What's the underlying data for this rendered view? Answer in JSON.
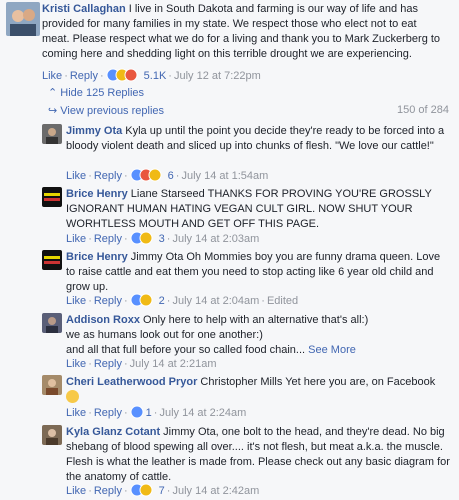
{
  "main_comment": {
    "author": "Kristi Callaghan",
    "text": "I live in South Dakota and farming is our way of life and has provided for many families in my state. We respect those who elect not to eat meat. Please respect what we do for a living and thank you to Mark Zuckerberg to coming here and shedding light on this terrible drought we are experiencing.",
    "like": "Like",
    "reply": "Reply",
    "reaction_count": "5.1K",
    "time": "July 12 at 7:22pm"
  },
  "hide_replies": "Hide 125 Replies",
  "view_previous": "View previous replies",
  "replies_count": "150 of 284",
  "replies": [
    {
      "author": "Jimmy Ota",
      "text": "Kyla up until the point you decide they're ready to be forced into a bloody violent death and sliced up into chunks of flesh. \"We love our cattle!\"",
      "reaction_count": "6",
      "time": "July 14 at 1:54am",
      "edited": ""
    },
    {
      "author": "Brice Henry",
      "text": "Liane Starseed THANKS FOR PROVING YOU'RE GROSSLY IGNORANT HUMAN HATING VEGAN CULT GIRL. NOW SHUT YOUR WORHTLESS MOUTH AND GET OFF THIS PAGE.",
      "reaction_count": "3",
      "time": "July 14 at 2:03am",
      "edited": ""
    },
    {
      "author": "Brice Henry",
      "text": "Jimmy Ota Oh Mommies boy you are funny drama queen. Love to raise cattle and eat them you need to stop acting like 6 year old child and grow up.",
      "reaction_count": "2",
      "time": "July 14 at 2:04am",
      "edited": "Edited"
    },
    {
      "author": "Addison Roxx",
      "text_lines": [
        "Only here to help with an alternative that's all:)",
        "we as humans look out for one another:)",
        "and all that full before your so called food chain..."
      ],
      "see_more": "See More",
      "time": "July 14 at 2:21am"
    },
    {
      "author": "Cheri Leatherwood Pryor",
      "text": "Christopher Mills Yet here you are, on Facebook",
      "reaction_count": "1",
      "time": "July 14 at 2:24am"
    },
    {
      "author": "Kyla Glanz Cotant",
      "text": "Jimmy Ota, one bolt to the head, and they're dead. No big shebang of blood spewing all over.... it's not flesh, but meat a.k.a. the muscle. Flesh is what the leather is made from. Please check out any basic diagram for the anatomy of cattle.",
      "reaction_count": "7",
      "time": "July 14 at 2:42am"
    }
  ],
  "labels": {
    "like": "Like",
    "reply": "Reply",
    "dot": "·"
  },
  "colors": {
    "link": "#4267b2",
    "name": "#365899",
    "meta": "#90949c",
    "bg": "#f6f7f9"
  }
}
